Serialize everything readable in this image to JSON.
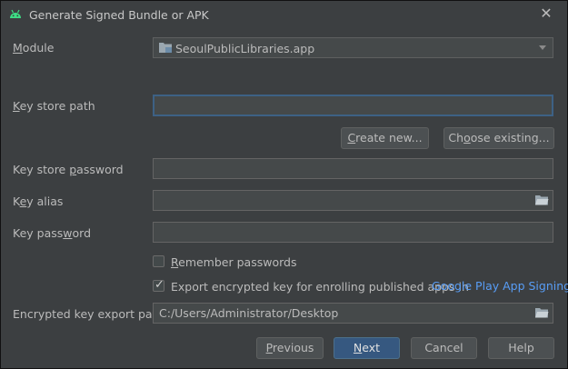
{
  "window": {
    "title": "Generate Signed Bundle or APK"
  },
  "module": {
    "label": "Module",
    "value": "SeoulPublicLibraries.app"
  },
  "key_store_path": {
    "label": "Key store path",
    "value": ""
  },
  "buttons": {
    "create_new": "Create new...",
    "choose_existing": "Choose existing...",
    "previous": "Previous",
    "next": "Next",
    "cancel": "Cancel",
    "help": "Help"
  },
  "key_store_password": {
    "label": "Key store password",
    "value": ""
  },
  "key_alias": {
    "label": "Key alias",
    "value": ""
  },
  "key_password": {
    "label": "Key password",
    "value": ""
  },
  "remember_passwords": {
    "label": "Remember passwords",
    "checked": false
  },
  "export_encrypted": {
    "label": "Export encrypted key for enrolling published apps in",
    "checked": true,
    "link": "Google Play App Signing"
  },
  "export_path": {
    "label": "Encrypted key export path",
    "value": "C:/Users/Administrator/Desktop"
  },
  "colors": {
    "accent": "#365880",
    "link": "#589df6",
    "background": "#3c3f41"
  }
}
